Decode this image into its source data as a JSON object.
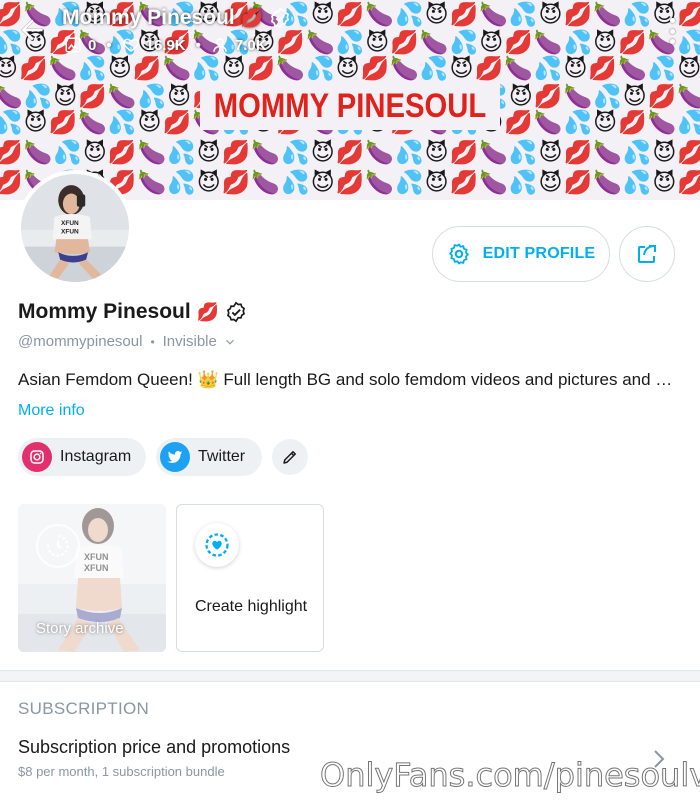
{
  "banner": {
    "title": "MOMMY PINESOUL",
    "emoji_rows": [
      "💋🍆💦😈💋🍆💦😈💋🍆💦😈💋🍆💦😈💋🍆💦😈💋🍆💦😈💋🍆💦😈",
      "💦😈💋🍆💦😈💋🍆💦😈💋🍆💦😈💋🍆💦😈💋🍆💦😈💋🍆💦😈💋🍆",
      "😈💋🍆💦😈💋🍆💦😈💋🍆💦😈💋🍆💦😈💋🍆💦😈💋🍆💦😈💋🍆💦",
      "🍆💦😈💋🍆💦😈💋🍆💦😈💋🍆💦😈💋🍆💦😈💋🍆💦😈💋🍆💦😈💋",
      "💦😈💋🍆💦😈💋🍆💦😈💋🍆💦😈💋🍆💦😈💋🍆💦😈💋🍆💦😈💋🍆",
      "💋🍆💦😈💋🍆💦😈💋🍆💦😈💋🍆💦😈💋🍆💦😈💋🍆💦😈💋🍆💦😈",
      "💋🍆💦😈💋🍆💦😈💋🍆💦😈💋🍆💦😈💋🍆💦😈💋🍆💦😈💋🍆💦😈"
    ]
  },
  "topbar": {
    "name": "Mommy Pinesoul",
    "name_emoji": "💋",
    "posts_count": "0",
    "likes_count": "16.9K",
    "fans_count": "7.0K",
    "separator": "•"
  },
  "profile": {
    "name": "Mommy Pinesoul",
    "name_emoji": "💋",
    "handle": "@mommypinesoul",
    "status": "Invisible",
    "bio": "Asian Femdom Queen! 👑 Full length BG and solo femdom videos and pictures and more!",
    "more_info": "More info",
    "dot": "•"
  },
  "actions": {
    "edit_profile": "EDIT PROFILE"
  },
  "socials": [
    {
      "label": "Instagram",
      "icon": "instagram-icon",
      "color": "#e1306c"
    },
    {
      "label": "Twitter",
      "icon": "twitter-icon",
      "color": "#1da1f2"
    }
  ],
  "highlights": {
    "story_archive": "Story archive",
    "create_highlight": "Create highlight"
  },
  "subscription": {
    "heading": "SUBSCRIPTION",
    "title": "Subscription price and promotions",
    "detail": "$8 per month, 1 subscription bundle"
  },
  "watermark": "OnlyFans.com/pinesoulvip",
  "colors": {
    "accent": "#00aff0",
    "muted": "#8a96a3",
    "banner_title": "#e0221b"
  }
}
